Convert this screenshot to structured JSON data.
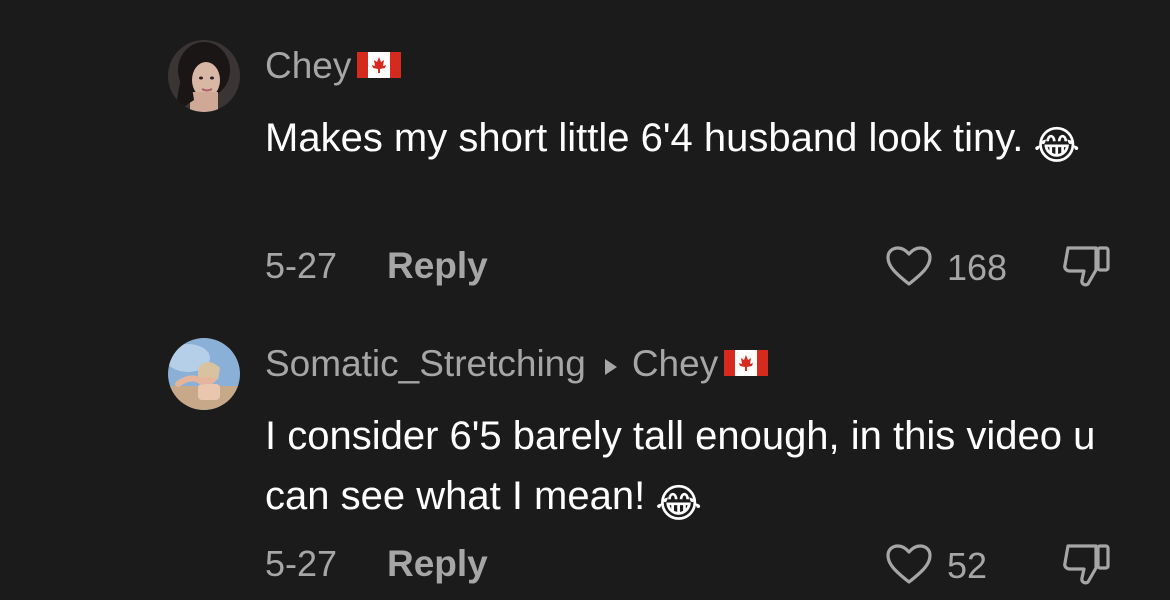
{
  "comments": [
    {
      "username": "Chey",
      "reply_to": "",
      "text": "Makes my short little 6'4 husband look tiny.",
      "emoji": "😂",
      "date": "5-27",
      "reply_label": "Reply",
      "likes": "168",
      "flag": "canada-flag-icon"
    },
    {
      "username": "Somatic_Stretching",
      "reply_to": "Chey",
      "text": "I consider 6'5 barely tall enough, in this video u can see what I mean!",
      "emoji": "😂",
      "date": "5-27",
      "reply_label": "Reply",
      "likes": "52",
      "flag": "canada-flag-icon"
    }
  ],
  "colors": {
    "background": "#1b1b1b",
    "secondary_text": "#a6a6a6",
    "primary_text": "#ffffff",
    "flag_red": "#d52b1e"
  }
}
